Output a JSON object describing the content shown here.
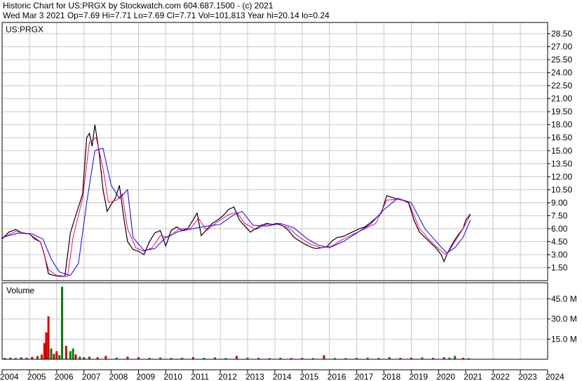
{
  "header": {
    "line1": "Historic Chart for US:PRGX by Stockwatch.com 604.687.1500 - (c) 2021",
    "line2": "Wed Mar  3 2021  Op=7.69  Hi=7.71  Lo=7.69  Cl=7.71  Vol=101,813  Year hi=20.14  lo=0.24"
  },
  "chart_data": [
    {
      "type": "line",
      "symbol_label": "US:PRGX",
      "y_ticks": [
        "28.50",
        "27.00",
        "25.50",
        "24.00",
        "22.50",
        "21.00",
        "19.50",
        "18.00",
        "16.50",
        "15.00",
        "13.50",
        "12.00",
        "10.50",
        "9.00",
        "7.50",
        "6.00",
        "4.50",
        "3.00",
        "1.50"
      ],
      "ylim": [
        0,
        29.8
      ],
      "x_ticks": [
        "2004",
        "2005",
        "2006",
        "2007",
        "2008",
        "2009",
        "2010",
        "2011",
        "2012",
        "2013",
        "2014",
        "2015",
        "2016",
        "2017",
        "2018",
        "2019",
        "2020",
        "2021",
        "2022",
        "2023",
        "2024"
      ],
      "grid": true,
      "series": [
        {
          "color": "#000000",
          "x": [
            2004.0,
            2004.25,
            2004.5,
            2004.75,
            2005.0,
            2005.2,
            2005.4,
            2005.55,
            2005.7,
            2005.9,
            2006.1,
            2006.3,
            2006.5,
            2006.6,
            2006.8,
            2006.95,
            2007.1,
            2007.2,
            2007.3,
            2007.4,
            2007.55,
            2007.7,
            2007.85,
            2008.0,
            2008.15,
            2008.3,
            2008.45,
            2008.6,
            2008.8,
            2008.9,
            2009.0,
            2009.2,
            2009.4,
            2009.6,
            2009.8,
            2010.0,
            2010.2,
            2010.4,
            2010.6,
            2010.8,
            2011.0,
            2011.15,
            2011.3,
            2011.5,
            2011.7,
            2011.9,
            2012.1,
            2012.3,
            2012.5,
            2012.7,
            2012.9,
            2013.1,
            2013.3,
            2013.5,
            2013.7,
            2013.9,
            2014.1,
            2014.3,
            2014.5,
            2014.7,
            2014.9,
            2015.1,
            2015.3,
            2015.5,
            2015.7,
            2015.9,
            2016.1,
            2016.3,
            2016.5,
            2016.7,
            2016.9,
            2017.1,
            2017.3,
            2017.5,
            2017.7,
            2017.9,
            2018.1,
            2018.3,
            2018.5,
            2018.7,
            2018.9,
            2019.1,
            2019.3,
            2019.5,
            2019.7,
            2019.9,
            2020.1,
            2020.2,
            2020.3,
            2020.5,
            2020.7,
            2020.9,
            2021.0,
            2021.17
          ],
          "values": [
            4.8,
            5.6,
            5.9,
            5.5,
            5.4,
            4.8,
            4.5,
            3.0,
            0.8,
            0.6,
            0.5,
            0.5,
            5.5,
            6.5,
            8.5,
            10.0,
            16.5,
            17.0,
            15.5,
            18.0,
            15.0,
            10.5,
            8.0,
            8.8,
            9.5,
            11.0,
            7.5,
            4.5,
            3.6,
            3.5,
            3.4,
            3.0,
            4.5,
            5.5,
            5.8,
            4.0,
            5.8,
            6.2,
            5.8,
            6.0,
            7.0,
            7.8,
            5.2,
            5.9,
            6.6,
            7.0,
            7.5,
            8.2,
            8.5,
            7.0,
            6.3,
            5.6,
            6.0,
            6.4,
            6.6,
            6.5,
            6.6,
            6.3,
            5.8,
            5.0,
            4.6,
            4.2,
            3.9,
            3.7,
            3.8,
            3.9,
            4.6,
            5.0,
            5.1,
            5.4,
            5.7,
            6.0,
            6.2,
            6.7,
            7.2,
            7.8,
            9.8,
            9.6,
            9.4,
            9.3,
            9.0,
            7.0,
            5.6,
            5.0,
            4.4,
            3.8,
            3.0,
            2.2,
            3.0,
            4.2,
            5.2,
            6.0,
            7.0,
            7.71
          ]
        },
        {
          "color": "#ff0066",
          "x": [
            2004.0,
            2004.5,
            2005.0,
            2005.4,
            2005.7,
            2006.0,
            2006.4,
            2006.6,
            2006.95,
            2007.2,
            2007.45,
            2007.7,
            2007.9,
            2008.2,
            2008.4,
            2008.6,
            2008.9,
            2009.2,
            2009.5,
            2009.8,
            2010.1,
            2010.5,
            2010.9,
            2011.2,
            2011.5,
            2011.9,
            2012.3,
            2012.6,
            2012.9,
            2013.3,
            2013.7,
            2014.1,
            2014.5,
            2014.9,
            2015.3,
            2015.7,
            2016.1,
            2016.5,
            2016.9,
            2017.3,
            2017.7,
            2018.1,
            2018.5,
            2018.9,
            2019.3,
            2019.7,
            2020.1,
            2020.3,
            2020.6,
            2020.9,
            2021.17
          ],
          "values": [
            4.9,
            5.7,
            5.4,
            4.5,
            1.3,
            0.6,
            0.5,
            5.0,
            9.5,
            16.0,
            16.5,
            13.0,
            9.0,
            9.3,
            10.0,
            6.0,
            3.8,
            3.4,
            3.8,
            5.2,
            5.0,
            6.0,
            6.0,
            7.2,
            5.8,
            6.8,
            7.6,
            7.9,
            6.6,
            5.9,
            6.5,
            6.5,
            6.1,
            5.0,
            4.2,
            3.8,
            4.0,
            4.8,
            5.4,
            6.0,
            6.6,
            9.3,
            9.4,
            9.1,
            6.0,
            4.6,
            3.4,
            3.0,
            4.5,
            6.0,
            7.6
          ]
        },
        {
          "color": "#0000ff",
          "x": [
            2004.0,
            2004.6,
            2005.1,
            2005.5,
            2005.8,
            2006.1,
            2006.5,
            2006.8,
            2007.1,
            2007.4,
            2007.7,
            2008.0,
            2008.3,
            2008.6,
            2008.8,
            2009.2,
            2009.6,
            2010.0,
            2010.5,
            2011.0,
            2011.5,
            2012.0,
            2012.5,
            2012.8,
            2013.2,
            2013.7,
            2014.2,
            2014.7,
            2015.2,
            2015.6,
            2016.0,
            2016.5,
            2017.0,
            2017.5,
            2018.0,
            2018.5,
            2019.0,
            2019.5,
            2020.0,
            2020.3,
            2020.6,
            2020.9,
            2021.17
          ],
          "values": [
            5.0,
            5.5,
            5.4,
            4.8,
            2.5,
            1.0,
            0.6,
            2.0,
            9.0,
            15.0,
            15.3,
            11.0,
            9.5,
            10.5,
            5.0,
            3.5,
            3.7,
            5.0,
            5.7,
            6.0,
            6.3,
            6.5,
            7.6,
            8.0,
            6.4,
            6.3,
            6.6,
            6.1,
            4.8,
            4.1,
            3.8,
            4.5,
            5.5,
            6.5,
            8.2,
            9.5,
            9.0,
            6.0,
            4.2,
            3.2,
            3.8,
            5.0,
            7.0
          ]
        }
      ]
    },
    {
      "type": "bar",
      "label": "Volume",
      "y_ticks": [
        "45.0 M",
        "30.0 M",
        "15.0 M"
      ],
      "ylim": [
        0,
        57
      ],
      "x": [
        2004.1,
        2004.3,
        2004.5,
        2004.7,
        2004.9,
        2005.1,
        2005.3,
        2005.45,
        2005.55,
        2005.62,
        2005.7,
        2005.8,
        2005.9,
        2006.0,
        2006.1,
        2006.2,
        2006.35,
        2006.5,
        2006.6,
        2006.7,
        2006.85,
        2007.0,
        2007.2,
        2007.5,
        2007.8,
        2008.2,
        2008.6,
        2009.0,
        2009.4,
        2009.8,
        2010.2,
        2010.6,
        2011.0,
        2011.4,
        2011.8,
        2012.2,
        2012.6,
        2013.0,
        2013.4,
        2013.8,
        2014.2,
        2014.6,
        2015.0,
        2015.4,
        2015.8,
        2016.2,
        2016.6,
        2017.0,
        2017.4,
        2017.8,
        2018.2,
        2018.6,
        2019.0,
        2019.4,
        2019.8,
        2020.2,
        2020.4,
        2020.6,
        2020.9,
        2021.1
      ],
      "values": [
        1.0,
        1.2,
        0.9,
        1.5,
        1.1,
        1.8,
        2.5,
        3.5,
        12.0,
        20.0,
        32.0,
        8.0,
        4.0,
        6.0,
        3.0,
        54.0,
        10.0,
        6.0,
        8.0,
        3.5,
        2.0,
        1.5,
        2.0,
        1.5,
        2.5,
        1.2,
        2.0,
        1.5,
        1.0,
        1.3,
        0.9,
        1.1,
        1.6,
        1.0,
        1.3,
        0.9,
        2.5,
        1.2,
        1.0,
        0.8,
        1.1,
        0.9,
        1.0,
        0.8,
        3.0,
        0.9,
        0.8,
        1.0,
        1.2,
        0.9,
        1.6,
        1.0,
        1.1,
        1.3,
        1.0,
        1.5,
        1.2,
        2.5,
        1.0,
        0.8
      ],
      "colors": [
        "#d40000",
        "#008000",
        "#d40000",
        "#008000",
        "#d40000",
        "#d40000",
        "#008000",
        "#d40000",
        "#d40000",
        "#d40000",
        "#d40000",
        "#008000",
        "#d40000",
        "#d40000",
        "#008000",
        "#008000",
        "#d40000",
        "#008000",
        "#008000",
        "#d40000",
        "#008000",
        "#d40000",
        "#008000",
        "#d40000",
        "#d40000",
        "#008000",
        "#d40000",
        "#d40000",
        "#008000",
        "#008000",
        "#d40000",
        "#008000",
        "#d40000",
        "#008000",
        "#d40000",
        "#008000",
        "#d40000",
        "#008000",
        "#d40000",
        "#d40000",
        "#008000",
        "#d40000",
        "#d40000",
        "#008000",
        "#d40000",
        "#008000",
        "#d40000",
        "#008000",
        "#008000",
        "#d40000",
        "#008000",
        "#d40000",
        "#d40000",
        "#008000",
        "#d40000",
        "#d40000",
        "#008000",
        "#008000",
        "#d40000",
        "#008000"
      ]
    }
  ]
}
